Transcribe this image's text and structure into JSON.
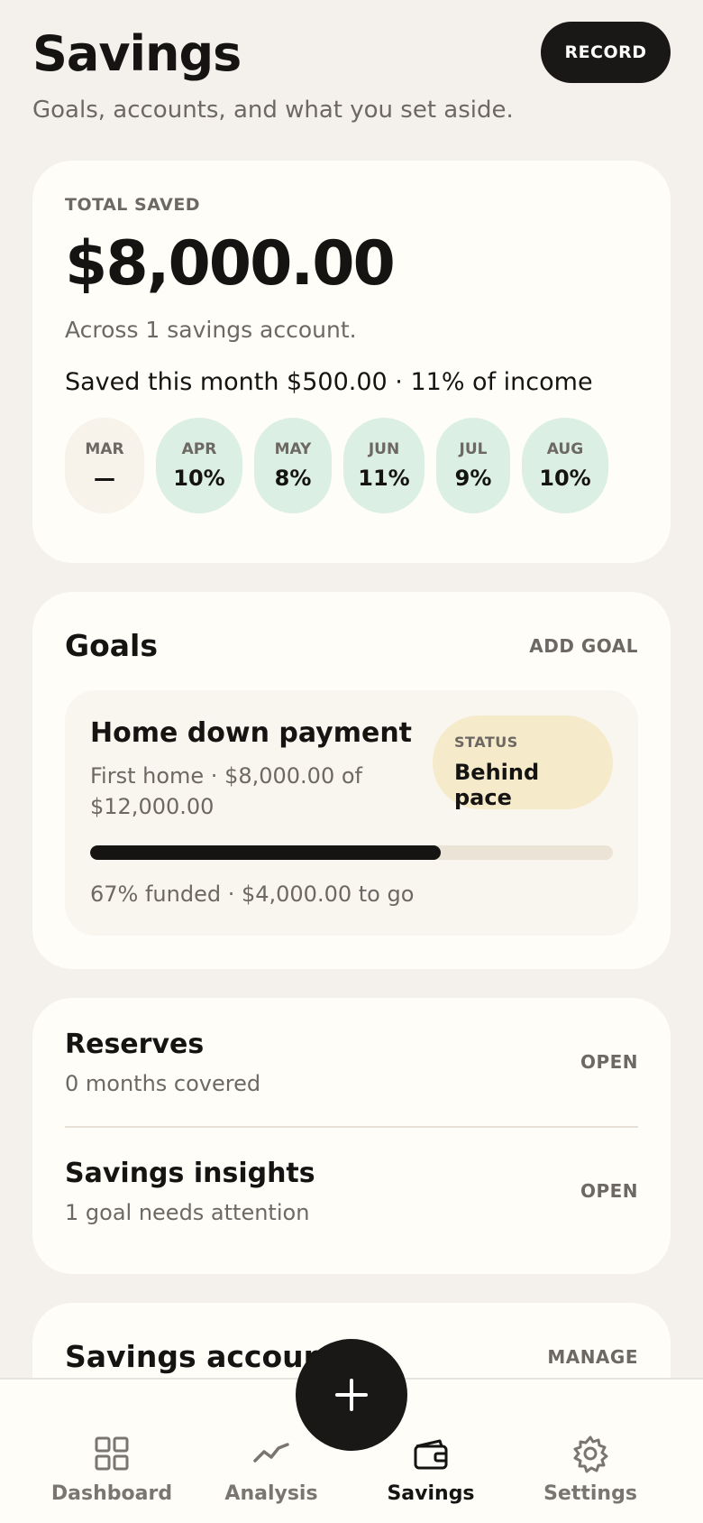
{
  "header": {
    "title": "Savings",
    "subtitle": "Goals, accounts, and what you set aside.",
    "record_label": "RECORD"
  },
  "total": {
    "eyebrow": "TOTAL SAVED",
    "amount": "$8,000.00",
    "accounts_note": "Across 1 savings account.",
    "month_line": "Saved this month $500.00 · 11% of income",
    "months": [
      {
        "label": "MAR",
        "value": "—"
      },
      {
        "label": "APR",
        "value": "10%"
      },
      {
        "label": "MAY",
        "value": "8%"
      },
      {
        "label": "JUN",
        "value": "11%"
      },
      {
        "label": "JUL",
        "value": "9%"
      },
      {
        "label": "AUG",
        "value": "10%"
      }
    ]
  },
  "goals": {
    "title": "Goals",
    "add_label": "ADD GOAL",
    "items": [
      {
        "title": "Home down payment",
        "meta": "First home · $8,000.00 of $12,000.00",
        "status_label": "STATUS",
        "status_value": "Behind pace",
        "progress": 0.67,
        "foot": "67% funded · $4,000.00 to go"
      }
    ]
  },
  "links": [
    {
      "title": "Reserves",
      "sub": "0 months covered",
      "action": "OPEN"
    },
    {
      "title": "Savings insights",
      "sub": "1 goal needs attention",
      "action": "OPEN"
    }
  ],
  "accounts": {
    "title": "Savings accounts",
    "manage_label": "MANAGE"
  },
  "nav": {
    "items": [
      {
        "label": "Dashboard",
        "icon": "grid-icon"
      },
      {
        "label": "Analysis",
        "icon": "trend-line-icon"
      },
      {
        "label": "Savings",
        "icon": "wallet-icon"
      },
      {
        "label": "Settings",
        "icon": "gear-icon"
      }
    ],
    "active": "Savings",
    "fab_icon": "plus-icon"
  },
  "colors": {
    "background": "#f4f1ec",
    "card": "#fefdf8",
    "ink": "#161412",
    "muted": "#6d6862",
    "chip_green": "#dcefe5",
    "status_yellow": "#f5ebcb"
  }
}
